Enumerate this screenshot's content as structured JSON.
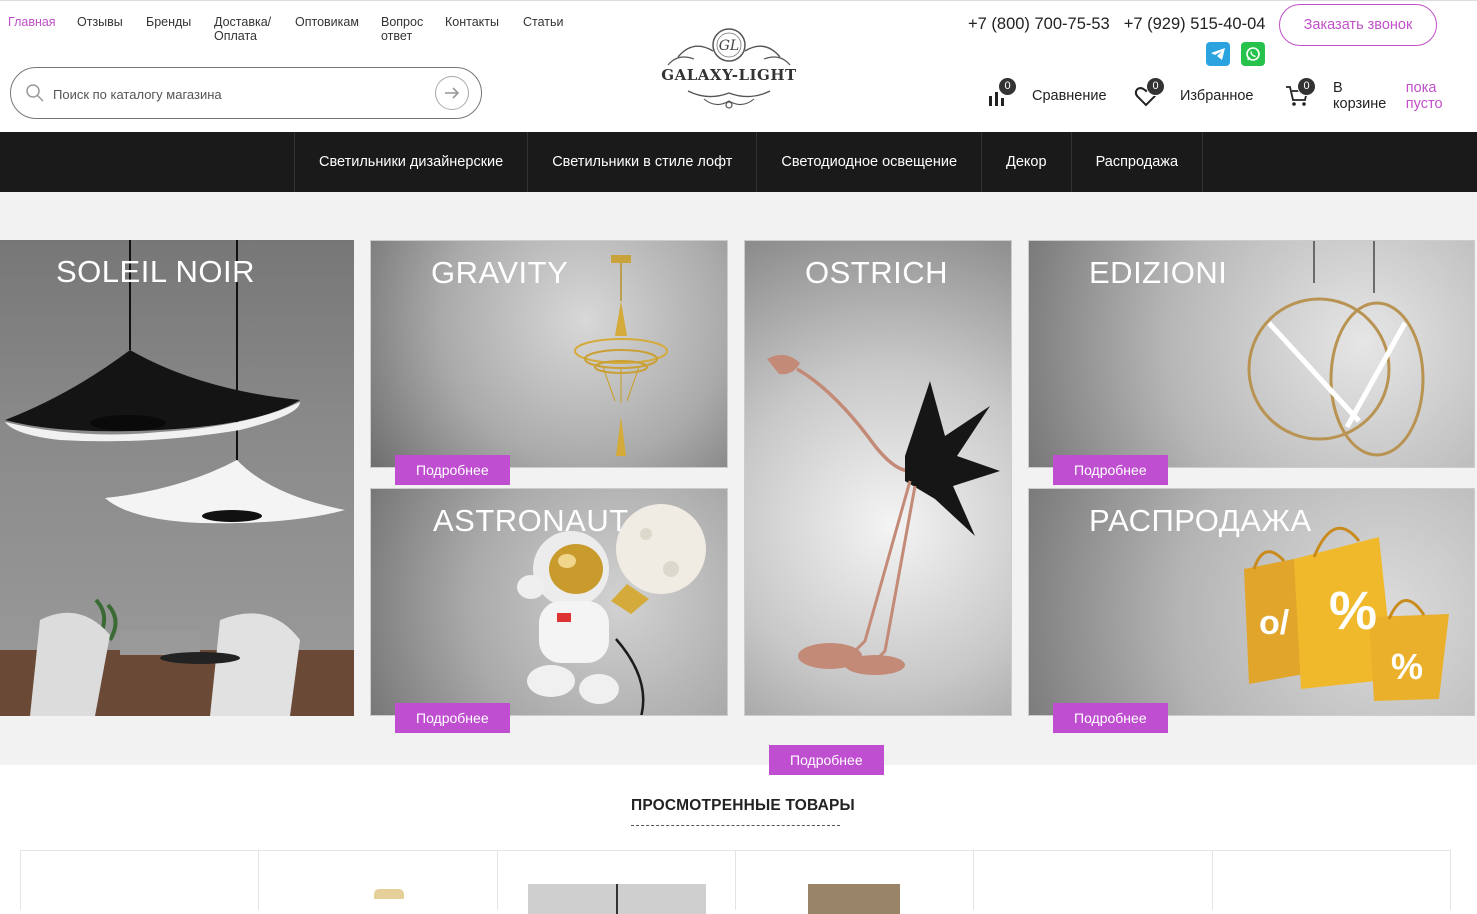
{
  "topnav": [
    {
      "label": "Главная",
      "active": true
    },
    {
      "label": "Отзывы"
    },
    {
      "label": "Бренды"
    },
    {
      "label": "Доставка/ Оплата"
    },
    {
      "label": "Оптовикам"
    },
    {
      "label": "Вопрос ответ"
    },
    {
      "label": "Контакты"
    },
    {
      "label": "Статьи"
    }
  ],
  "search": {
    "placeholder": "Поиск по каталогу магазина"
  },
  "logo": {
    "text": "GALAXY-LIGHT",
    "monogram": "GL"
  },
  "phones": [
    "+7 (800) 700-75-53",
    "+7 (929) 515-40-04"
  ],
  "call_button": "Заказать звонок",
  "messengers": [
    "telegram-icon",
    "whatsapp-icon"
  ],
  "tools": {
    "compare": {
      "label": "Сравнение",
      "count": "0"
    },
    "favorites": {
      "label": "Избранное",
      "count": "0"
    },
    "cart": {
      "label": "В корзине",
      "status": "пока пусто",
      "count": "0"
    }
  },
  "mainnav": [
    "Светильники дизайнерские",
    "Светильники в стиле лофт",
    "Светодиодное освещение",
    "Декор",
    "Распродажа"
  ],
  "banners": {
    "soleil": {
      "title": "SOLEIL NOIR"
    },
    "gravity": {
      "title": "GRAVITY",
      "button": "Подробнее"
    },
    "astronaut": {
      "title": "ASTRONAUT",
      "button": "Подробнее"
    },
    "ostrich": {
      "title": "OSTRICH"
    },
    "edizioni": {
      "title": "EDIZIONI",
      "button": "Подробнее"
    },
    "sale": {
      "title": "РАСПРОДАЖА",
      "button": "Подробнее"
    },
    "more_button": "Подробнее"
  },
  "recent": {
    "title": "ПРОСМОТРЕННЫЕ ТОВАРЫ"
  },
  "colors": {
    "accent": "#c050c8",
    "button": "#bf4fd0",
    "nav_bg": "#1a1a1a"
  }
}
